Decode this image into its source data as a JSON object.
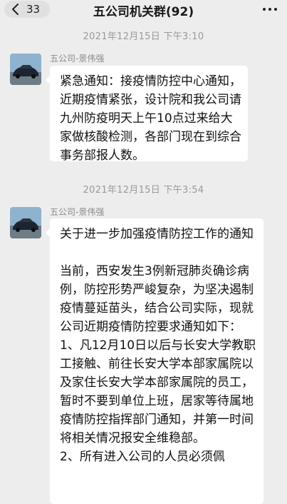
{
  "header": {
    "back_count": "33",
    "title": "五公司机关群(92)"
  },
  "messages": [
    {
      "time": "2021年12月15日 下午3:10",
      "sender": "五公司-景伟强",
      "text": "紧急通知：接疫情防控中心通知，近期疫情紧张，设计院和我公司请九州防疫明天上午10点过来给大家做核酸检测，各部门现在到综合事务部报人数。"
    },
    {
      "time": "2021年12月15日 下午3:54",
      "sender": "五公司-景伟强",
      "title": "关于进一步加强疫情防控工作的通知",
      "body": "当前，西安发生3例新冠肺炎确诊病例，防控形势严峻复杂，为坚决遏制疫情蔓延苗头，结合公司实际，现就公司近期疫情防控要求通知如下：",
      "item1": "1、凡12月10日以后与长安大学教职工接触、前往长安大学本部家属院以及家住长安大学本部家属院的员工，暂时不要到单位上班，居家等待属地疫情防控指挥部门通知，并第一时间将相关情况报安全维稳部。",
      "item2": "2、所有进入公司的人员必须佩"
    }
  ],
  "colors": {
    "background": "#ededed",
    "bubble": "#ffffff",
    "timestamp": "#9a9a9a",
    "sender": "#8c8c8c"
  },
  "icons": {
    "back": "chevron-left-icon",
    "more": "more-dots-icon",
    "avatar": "car-avatar"
  }
}
